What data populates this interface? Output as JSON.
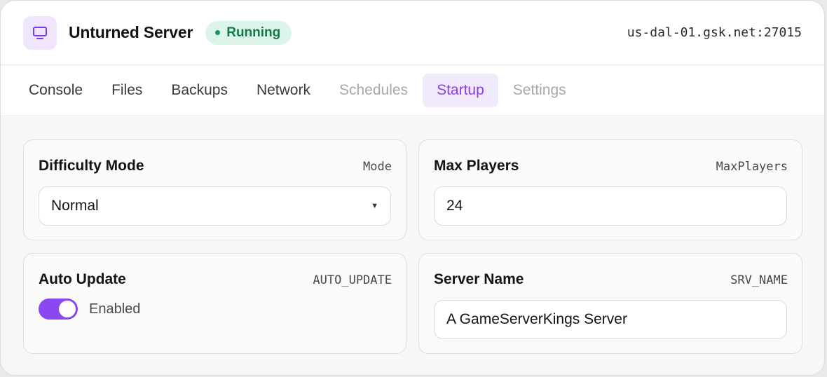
{
  "header": {
    "icon": "monitor-icon",
    "title": "Unturned Server",
    "status": "Running",
    "status_color": "#157a4a",
    "address": "us-dal-01.gsk.net:27015"
  },
  "tabs": [
    {
      "label": "Console",
      "state": "normal"
    },
    {
      "label": "Files",
      "state": "normal"
    },
    {
      "label": "Backups",
      "state": "normal"
    },
    {
      "label": "Network",
      "state": "normal"
    },
    {
      "label": "Schedules",
      "state": "disabled"
    },
    {
      "label": "Startup",
      "state": "active"
    },
    {
      "label": "Settings",
      "state": "disabled"
    }
  ],
  "accent_color": "#8b47f0",
  "variables": {
    "difficulty": {
      "title": "Difficulty Mode",
      "var": "Mode",
      "value": "Normal",
      "input": "select"
    },
    "max_players": {
      "title": "Max Players",
      "var": "MaxPlayers",
      "value": "24",
      "input": "text"
    },
    "auto_update": {
      "title": "Auto Update",
      "var": "AUTO_UPDATE",
      "value": "Enabled",
      "input": "toggle",
      "on": true
    },
    "server_name": {
      "title": "Server Name",
      "var": "SRV_NAME",
      "value": "A GameServerKings Server",
      "input": "text"
    }
  }
}
